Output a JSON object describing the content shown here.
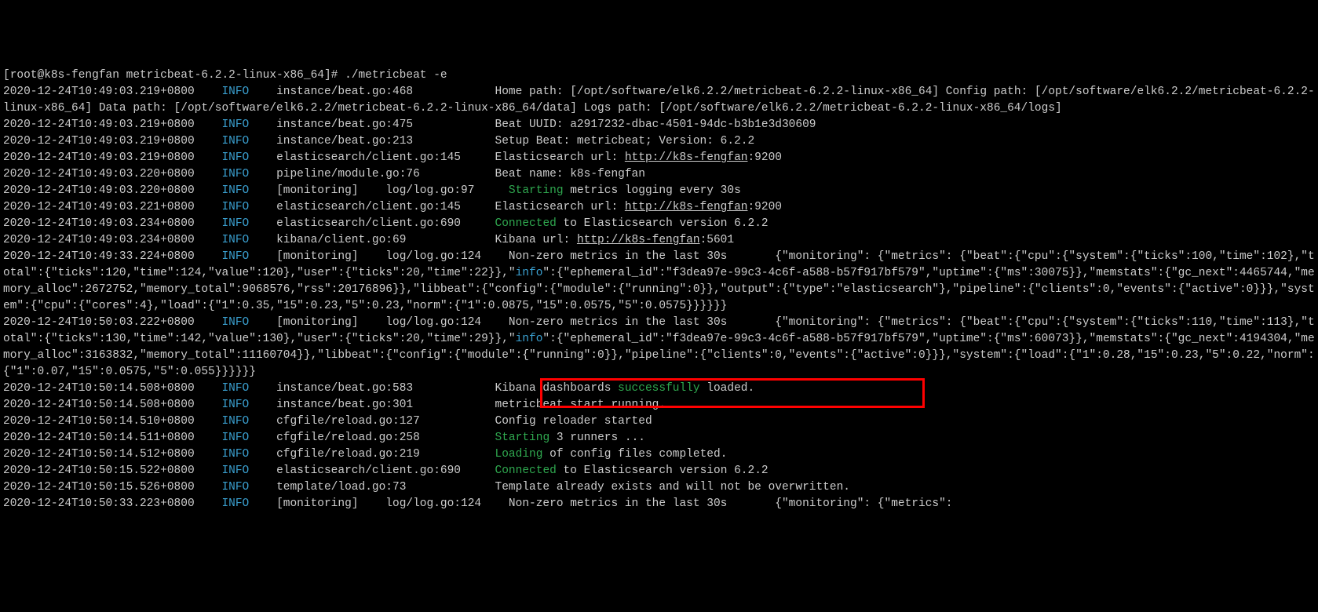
{
  "prompt": "[root@k8s-fengfan metricbeat-6.2.2-linux-x86_64]# ./metricbeat -e",
  "lines": [
    {
      "ts": "2020-12-24T10:49:03.219+0800",
      "lvl": "INFO",
      "src": "instance/beat.go:468",
      "msg_pre": "Home path: [/opt/software/elk6.2.2/metricbeat-6.2.2-linux-x86_64] Config path: [/opt/software/elk6.2.2/metricbeat-6.2.2-linux-x86_64] Data path: [/opt/software/elk6.2.2/metricbeat-6.2.2-linux-x86_64/data] Logs path: [/opt/software/elk6.2.2/metricbeat-6.2.2-linux-x86_64/logs]"
    },
    {
      "ts": "2020-12-24T10:49:03.219+0800",
      "lvl": "INFO",
      "src": "instance/beat.go:475",
      "msg_pre": "Beat UUID: a2917232-dbac-4501-94dc-b3b1e3d30609"
    },
    {
      "ts": "2020-12-24T10:49:03.219+0800",
      "lvl": "INFO",
      "src": "instance/beat.go:213",
      "msg_pre": "Setup Beat: metricbeat; Version: 6.2.2"
    },
    {
      "ts": "2020-12-24T10:49:03.219+0800",
      "lvl": "INFO",
      "src": "elasticsearch/client.go:145",
      "msg_pre": "Elasticsearch url: ",
      "url": "http://k8s-fengfan",
      "msg_post": ":9200"
    },
    {
      "ts": "2020-12-24T10:49:03.220+0800",
      "lvl": "INFO",
      "src": "pipeline/module.go:76",
      "msg_pre": "Beat name: k8s-fengfan"
    },
    {
      "ts": "2020-12-24T10:49:03.220+0800",
      "lvl": "INFO",
      "src": "[monitoring]",
      "src2": "log/log.go:97",
      "starting": "Starting",
      "msg_post": " metrics logging every 30s"
    },
    {
      "ts": "2020-12-24T10:49:03.221+0800",
      "lvl": "INFO",
      "src": "elasticsearch/client.go:145",
      "msg_pre": "Elasticsearch url: ",
      "url": "http://k8s-fengfan",
      "msg_post": ":9200"
    },
    {
      "ts": "2020-12-24T10:49:03.234+0800",
      "lvl": "INFO",
      "src": "elasticsearch/client.go:690",
      "connected": "Connected",
      "msg_post": " to Elasticsearch version 6.2.2"
    },
    {
      "ts": "2020-12-24T10:49:03.234+0800",
      "lvl": "INFO",
      "src": "kibana/client.go:69",
      "msg_pre": "Kibana url: ",
      "url": "http://k8s-fengfan",
      "msg_post": ":5601"
    },
    {
      "ts": "2020-12-24T10:49:33.224+0800",
      "lvl": "INFO",
      "src": "[monitoring]",
      "src2": "log/log.go:124",
      "msg_pre": "Non-zero metrics in the last 30s",
      "json_pre": "{\"monitoring\": {\"metrics\": {\"beat\":{\"cpu\":{\"system\":{\"ticks\":100,\"time\":102},\"total\":{\"ticks\":120,\"time\":124,\"value\":120},\"user\":{\"ticks\":20,\"time\":22}},\"",
      "info_key": "info",
      "json_post": "\":{\"ephemeral_id\":\"f3dea97e-99c3-4c6f-a588-b57f917bf579\",\"uptime\":{\"ms\":30075}},\"memstats\":{\"gc_next\":4465744,\"memory_alloc\":2672752,\"memory_total\":9068576,\"rss\":20176896}},\"libbeat\":{\"config\":{\"module\":{\"running\":0}},\"output\":{\"type\":\"elasticsearch\"},\"pipeline\":{\"clients\":0,\"events\":{\"active\":0}}},\"system\":{\"cpu\":{\"cores\":4},\"load\":{\"1\":0.35,\"15\":0.23,\"5\":0.23,\"norm\":{\"1\":0.0875,\"15\":0.0575,\"5\":0.0575}}}}}}"
    },
    {
      "ts": "2020-12-24T10:50:03.222+0800",
      "lvl": "INFO",
      "src": "[monitoring]",
      "src2": "log/log.go:124",
      "msg_pre": "Non-zero metrics in the last 30s",
      "json_pre": "{\"monitoring\": {\"metrics\": {\"beat\":{\"cpu\":{\"system\":{\"ticks\":110,\"time\":113},\"total\":{\"ticks\":130,\"time\":142,\"value\":130},\"user\":{\"ticks\":20,\"time\":29}},\"",
      "info_key": "info",
      "json_post": "\":{\"ephemeral_id\":\"f3dea97e-99c3-4c6f-a588-b57f917bf579\",\"uptime\":{\"ms\":60073}},\"memstats\":{\"gc_next\":4194304,\"memory_alloc\":3163832,\"memory_total\":11160704}},\"libbeat\":{\"config\":{\"module\":{\"running\":0}},\"pipeline\":{\"clients\":0,\"events\":{\"active\":0}}},\"system\":{\"load\":{\"1\":0.28,\"15\":0.23,\"5\":0.22,\"norm\":{\"1\":0.07,\"15\":0.0575,\"5\":0.055}}}}}}"
    },
    {
      "ts": "2020-12-24T10:50:14.508+0800",
      "lvl": "INFO",
      "src": "instance/beat.go:583",
      "msg_pre": "Kibana dashboards ",
      "success": "successfully",
      "msg_post": " loaded."
    },
    {
      "ts": "2020-12-24T10:50:14.508+0800",
      "lvl": "INFO",
      "src": "instance/beat.go:301",
      "msg_pre": "metricbeat start running."
    },
    {
      "ts": "2020-12-24T10:50:14.510+0800",
      "lvl": "INFO",
      "src": "cfgfile/reload.go:127",
      "msg_pre": "Config reloader started"
    },
    {
      "ts": "2020-12-24T10:50:14.511+0800",
      "lvl": "INFO",
      "src": "cfgfile/reload.go:258",
      "starting": "Starting",
      "msg_post": " 3 runners ..."
    },
    {
      "ts": "2020-12-24T10:50:14.512+0800",
      "lvl": "INFO",
      "src": "cfgfile/reload.go:219",
      "starting": "Loading",
      "msg_post": " of config files completed."
    },
    {
      "ts": "2020-12-24T10:50:15.522+0800",
      "lvl": "INFO",
      "src": "elasticsearch/client.go:690",
      "connected": "Connected",
      "msg_post": " to Elasticsearch version 6.2.2"
    },
    {
      "ts": "2020-12-24T10:50:15.526+0800",
      "lvl": "INFO",
      "src": "template/load.go:73",
      "msg_pre": "Template already exists and will not be overwritten."
    },
    {
      "ts": "2020-12-24T10:50:33.223+0800",
      "lvl": "INFO",
      "src": "[monitoring]",
      "src2": "log/log.go:124",
      "msg_pre": "Non-zero metrics in the last 30s",
      "json_pre": "{\"monitoring\": {\"metrics\":"
    }
  ]
}
